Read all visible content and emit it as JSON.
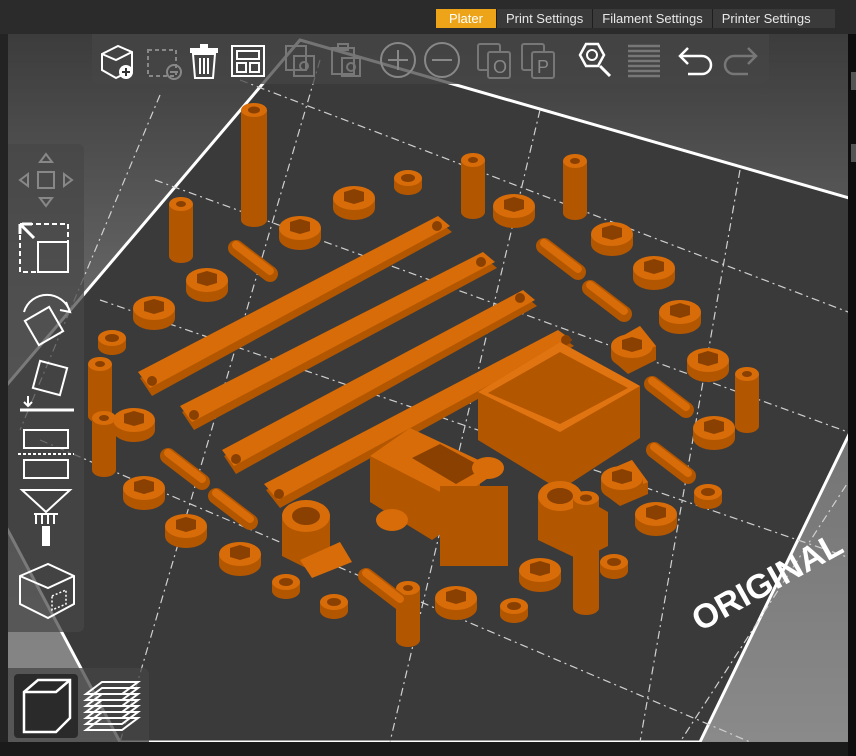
{
  "tabs": [
    {
      "label": "Plater",
      "active": true
    },
    {
      "label": "Print Settings",
      "active": false
    },
    {
      "label": "Filament Settings",
      "active": false
    },
    {
      "label": "Printer Settings",
      "active": false
    }
  ],
  "toolbar_icons": [
    "add-icon",
    "delete-icon",
    "delete-all-icon",
    "arrange-icon",
    "copy-icon",
    "paste-icon",
    "increase-instances-icon",
    "decrease-instances-icon",
    "split-to-objects-icon",
    "split-to-parts-icon",
    "search-icon",
    "layer-editing-icon",
    "undo-icon",
    "redo-icon"
  ],
  "left_tool_icons": [
    "move-icon",
    "scale-icon",
    "rotate-icon",
    "place-on-face-icon",
    "cut-icon",
    "paint-supports-icon",
    "hollow-icon"
  ],
  "view_icons": [
    "3d-view-icon",
    "preview-icon"
  ],
  "bed": {
    "label": "ORIGINAL"
  },
  "colors": {
    "accent": "#eda418",
    "filament": "#cc6600"
  }
}
